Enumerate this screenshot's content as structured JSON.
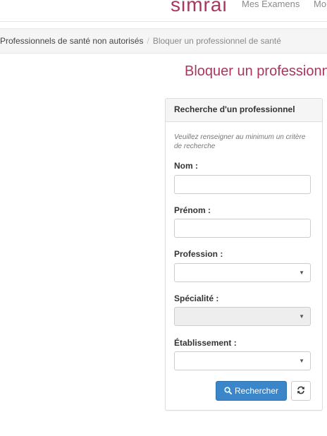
{
  "nav": {
    "brand": "simrai",
    "links": [
      "Mes Examens",
      "Mo"
    ]
  },
  "breadcrumb": {
    "link": "Professionnels de santé non autorisés",
    "separator": "/",
    "active": "Bloquer un professionnel de santé"
  },
  "page": {
    "title": "Bloquer un professionn"
  },
  "panel": {
    "heading": "Recherche d'un professionnel",
    "hint": "Veuillez renseigner au minimum un critère de recherche",
    "fields": {
      "nom": {
        "label": "Nom :",
        "value": ""
      },
      "prenom": {
        "label": "Prénom :",
        "value": ""
      },
      "profession": {
        "label": "Profession :",
        "selected": ""
      },
      "specialite": {
        "label": "Spécialité :",
        "selected": "",
        "disabled": true
      },
      "etablissement": {
        "label": "Établissement :",
        "selected": ""
      }
    },
    "search_button": "Rechercher",
    "icons": {
      "search": "search-icon",
      "reset": "refresh-icon",
      "caret": "caret-down-icon"
    }
  },
  "colors": {
    "brand": "#a8375e",
    "primary_button": "#3a86c8",
    "panel_heading_bg": "#f5f5f5",
    "disabled_bg": "#eeeeee"
  }
}
